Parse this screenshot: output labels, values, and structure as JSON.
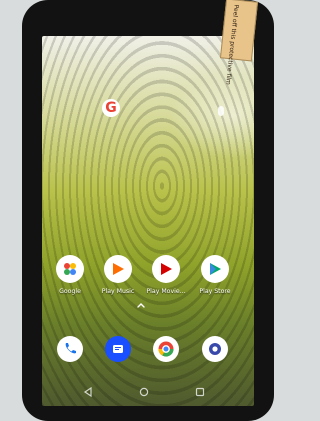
{
  "sticker": {
    "text": "Peel off this protective film"
  },
  "homescreen": {
    "apps_row": [
      {
        "label": "Google",
        "icon": "google-folder-icon"
      },
      {
        "label": "Play Music",
        "icon": "play-music-icon"
      },
      {
        "label": "Play Movie...",
        "icon": "play-movies-icon"
      },
      {
        "label": "Play Store",
        "icon": "play-store-icon"
      }
    ],
    "dock": [
      {
        "icon": "phone-icon"
      },
      {
        "icon": "messages-icon"
      },
      {
        "icon": "chrome-icon"
      },
      {
        "icon": "camera-icon"
      }
    ]
  },
  "colors": {
    "phone_body": "#121212",
    "wallpaper_green": "#b9c24a",
    "accent_blue": "#1a73e8"
  }
}
